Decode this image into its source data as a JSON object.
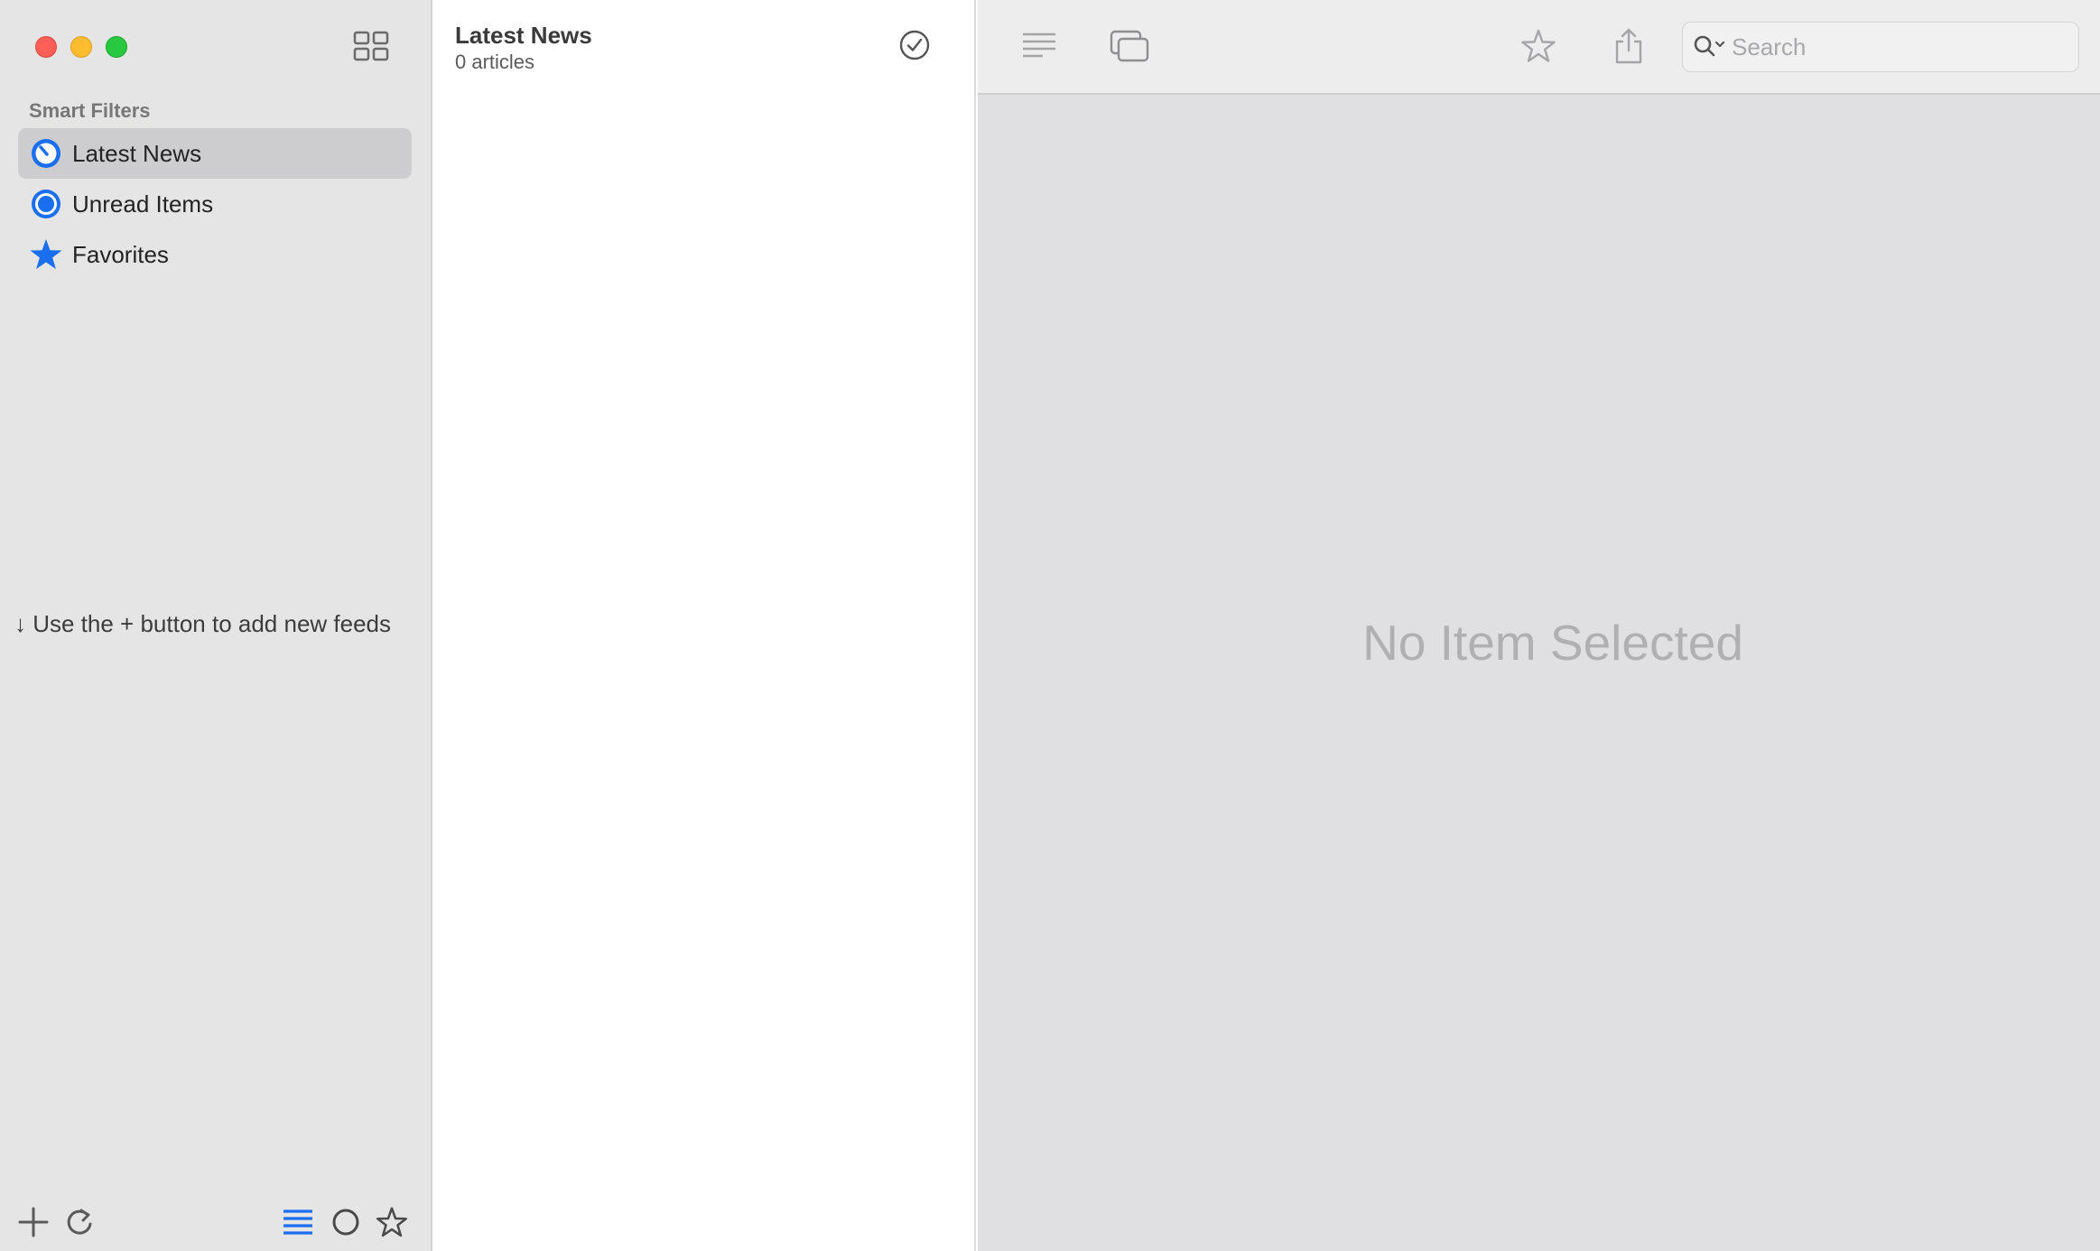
{
  "sidebar": {
    "section_label": "Smart Filters",
    "items": [
      {
        "label": "Latest News",
        "icon": "clock-icon",
        "selected": true
      },
      {
        "label": "Unread Items",
        "icon": "unread-circle-icon",
        "selected": false
      },
      {
        "label": "Favorites",
        "icon": "star-icon",
        "selected": false
      }
    ],
    "hint": "↓ Use the + button to add new feeds"
  },
  "list": {
    "title": "Latest News",
    "count": "0 articles"
  },
  "toolbar": {
    "search_placeholder": "Search"
  },
  "detail": {
    "empty_text": "No Item Selected"
  },
  "colors": {
    "accent": "#1a6ff0",
    "sidebar_bg": "#e5e5e6",
    "selected_bg": "#cdcdd0",
    "detail_bg": "#e0e0e2"
  }
}
